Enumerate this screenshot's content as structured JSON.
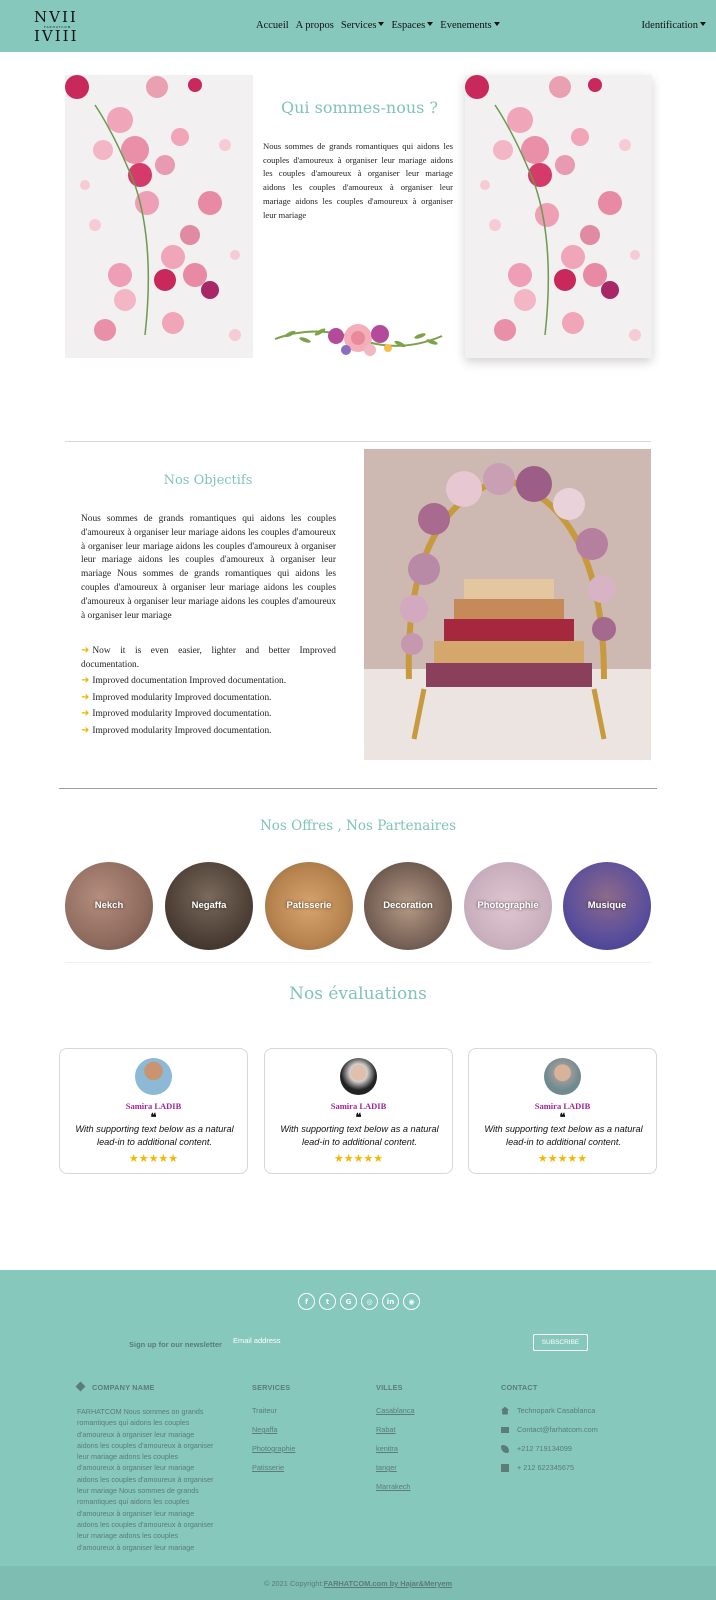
{
  "navbar": {
    "logo_line1": "NVII",
    "logo_line2": "IVIII",
    "logo_sub": "FARHATCOM",
    "menu": [
      {
        "label": "Accueil",
        "dropdown": false
      },
      {
        "label": "A propos",
        "dropdown": false
      },
      {
        "label": "Services",
        "dropdown": true
      },
      {
        "label": "Espaces",
        "dropdown": true
      },
      {
        "label": "Evenements",
        "dropdown": true
      }
    ],
    "identification": "Identification"
  },
  "about": {
    "title": "Qui sommes-nous ?",
    "text": "Nous sommes de grands romantiques qui aidons les couples d'amoureux à organiser leur mariage aidons les couples d'amoureux à organiser leur mariage aidons les couples d'amoureux à organiser leur mariage aidons les couples d'amoureux à organiser leur mariage"
  },
  "objectives": {
    "title": "Nos Objectifs",
    "text": "Nous sommes de grands romantiques qui aidons les couples d'amoureux à organiser leur mariage aidons les couples d'amoureux à organiser leur mariage aidons les couples d'amoureux à organiser leur mariage aidons les couples d'amoureux à organiser leur mariage Nous sommes de grands romantiques qui aidons les couples d'amoureux à organiser leur mariage aidons les couples d'amoureux à organiser leur mariage aidons les couples d'amoureux à organiser leur mariage",
    "items": [
      "Now it is even easier, lighter and better Improved documentation.",
      "Improved documentation Improved documentation.",
      "Improved modularity Improved documentation.",
      "Improved modularity Improved documentation.",
      "Improved modularity Improved documentation."
    ]
  },
  "offers": {
    "title": "Nos Offres , Nos Partenaires",
    "items": [
      "Nekch",
      "Negaffa",
      "Patisserie",
      "Decoration",
      "Photographie",
      "Musique"
    ]
  },
  "reviews": {
    "title": "Nos évaluations",
    "items": [
      {
        "name": "Samira LADIB",
        "quote": "❝",
        "text": "With supporting text below as a natural lead-in to additional content.",
        "stars": "★★★★★"
      },
      {
        "name": "Samira LADIB",
        "quote": "❝",
        "text": "With supporting text below as a natural lead-in to additional content.",
        "stars": "★★★★★"
      },
      {
        "name": "Samira LADIB",
        "quote": "❝",
        "text": "With supporting text below as a natural lead-in to additional content.",
        "stars": "★★★★★"
      }
    ]
  },
  "footer": {
    "social": [
      "f",
      "t",
      "G",
      "◎",
      "in",
      "◉"
    ],
    "newsletter_label": "Sign up for our newsletter",
    "newsletter_placeholder": "Email address",
    "subscribe": "SUBSCRIBE",
    "company": {
      "title": "COMPANY NAME",
      "text": "FARHATCOM Nous sommes on grands romantiques qui aidons les couples d'amoureux à organiser leur mariage aidons les couples d'amoureux à organiser leur mariage aidons les couples d'amoureux à organiser leur mariage aidons les couples d'amoureux à organiser leur mariage Nous sommes de grands romantiques qui aidons les couples d'amoureux à organiser leur mariage aidons les couples d'amoureux à organiser leur mariage aidons les couples d'amoureux à organiser leur mariage"
    },
    "services": {
      "title": "SERVICES",
      "items": [
        "Traiteur",
        "Negaffa",
        "Photographie",
        "Patisserie"
      ]
    },
    "villes": {
      "title": "VILLES",
      "items": [
        "Casablanca",
        "Rabat",
        "kenitra",
        "tanger",
        "Marrakech"
      ]
    },
    "contact": {
      "title": "CONTACT",
      "items": [
        {
          "icon": "home-icon",
          "text": "Technopark Casablanca"
        },
        {
          "icon": "envelope-icon",
          "text": "Contact@farhatcom.com"
        },
        {
          "icon": "phone-icon",
          "text": "+212 719134099"
        },
        {
          "icon": "print-icon",
          "text": "+ 212 622345675"
        }
      ]
    },
    "copyright_prefix": "© 2021 Copyright:",
    "copyright_link": "FARHATCOM.com by Hajar&Meryem"
  },
  "colors": {
    "brand": "#86c8bc",
    "heading": "#7fc4b7",
    "name": "#a0259a",
    "star": "#f5b800"
  }
}
